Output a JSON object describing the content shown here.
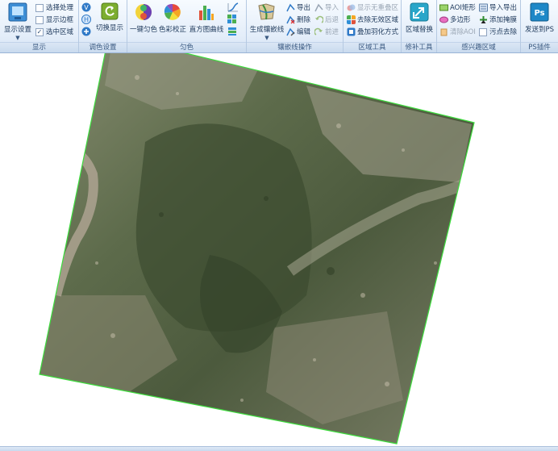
{
  "ribbon": {
    "groups": {
      "display": {
        "caption": "显示",
        "big_button": "显示设置",
        "options": [
          {
            "label": "选择处理",
            "checked": false
          },
          {
            "label": "显示边框",
            "checked": false
          },
          {
            "label": "选中区域",
            "checked": true
          }
        ]
      },
      "color_settings": {
        "caption": "调色设置",
        "small_icons": [
          "V",
          "H",
          "+"
        ],
        "big_button": "切换显示"
      },
      "dodging": {
        "caption": "匀色",
        "buttons": [
          "一键匀色",
          "色彩校正",
          "直方图曲线"
        ]
      },
      "seamline": {
        "caption": "镶嵌线操作",
        "big_button": "生成镶嵌线",
        "col1": [
          "导出",
          "删除",
          "编辑"
        ],
        "col2": [
          "导入",
          "后退",
          "前进"
        ]
      },
      "region_tools": {
        "caption": "区域工具",
        "items": [
          "显示无重叠区",
          "去除无效区域",
          "叠加羽化方式"
        ]
      },
      "repair_tools": {
        "caption": "修补工具",
        "big_button": "区域替换"
      },
      "aoi": {
        "caption": "感兴趣区域",
        "col1": [
          "AOI矩形",
          "多边形",
          "清除AOI"
        ],
        "col2": [
          "导入导出",
          "添加掩膜",
          "污点去除"
        ]
      },
      "ps_plugin": {
        "caption": "PS插件",
        "big_button": "发送到PS"
      }
    }
  },
  "colors": {
    "ribbon_bg": "#e3edf9",
    "border_green": "#3ddc3d",
    "status_bg": "#c8d9ee"
  }
}
